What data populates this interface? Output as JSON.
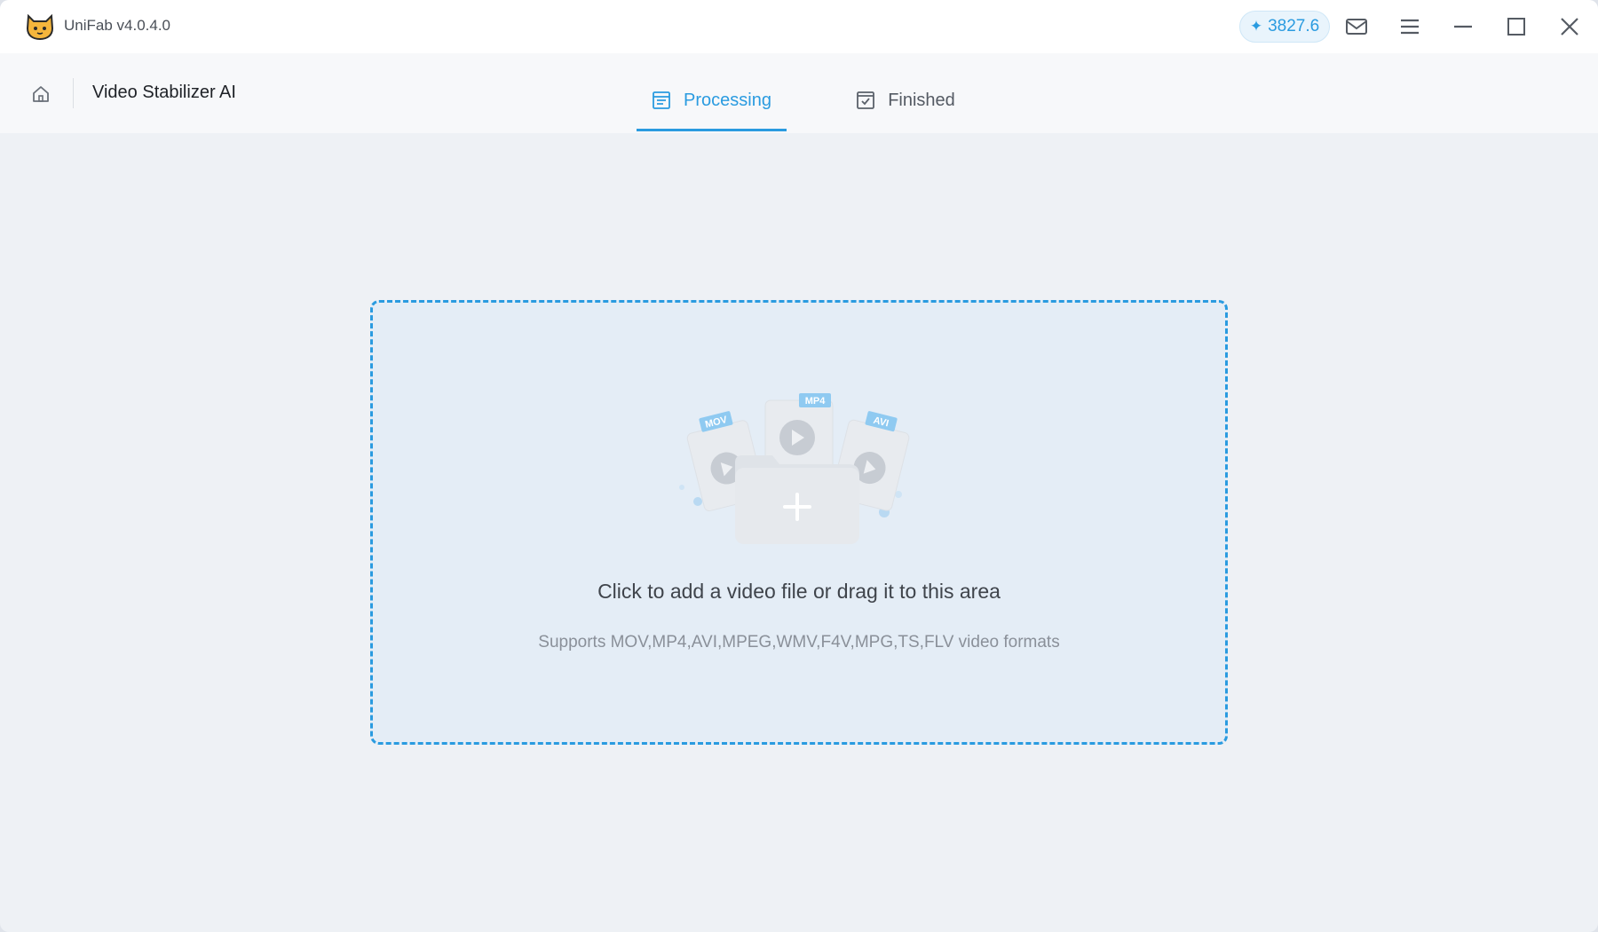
{
  "app": {
    "title": "UniFab v4.0.4.0",
    "credits": "3827.6"
  },
  "header": {
    "page_title": "Video Stabilizer AI",
    "tabs": [
      {
        "label": "Processing",
        "active": true
      },
      {
        "label": "Finished",
        "active": false
      }
    ]
  },
  "dropzone": {
    "main_text": "Click to add a video file or drag it to this area",
    "sub_text": "Supports MOV,MP4,AVI,MPEG,WMV,F4V,MPG,TS,FLV video formats",
    "file_tags": [
      "MOV",
      "MP4",
      "AVI"
    ]
  },
  "icons": {
    "logo": "cat-logo-icon",
    "credits": "sparkle-icon",
    "mail": "mail-icon",
    "menu": "hamburger-menu-icon",
    "minimize": "minimize-icon",
    "maximize": "maximize-icon",
    "close": "close-icon",
    "home": "home-icon",
    "processing": "list-icon",
    "finished": "checkbox-icon",
    "add_file": "folder-plus-icon"
  },
  "colors": {
    "accent": "#2a9be0",
    "background": "#eef1f5",
    "dropzone_bg": "#e4edf6"
  }
}
